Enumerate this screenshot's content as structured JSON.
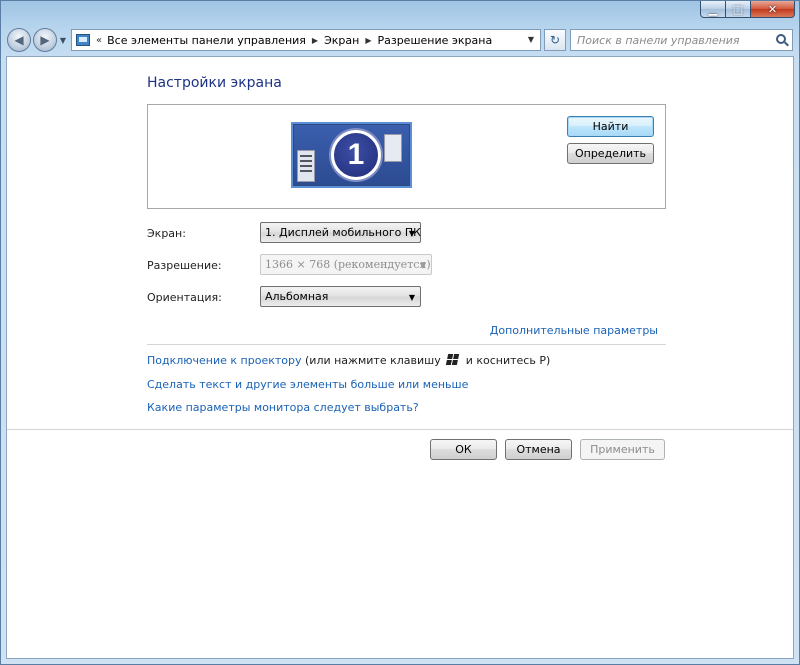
{
  "nav": {
    "breadcrumbs": [
      "Все элементы панели управления",
      "Экран",
      "Разрешение экрана"
    ],
    "overflow_glyph": "«",
    "search_placeholder": "Поиск в панели управления"
  },
  "page": {
    "title": "Настройки экрана",
    "monitor_number": "1",
    "identify_buttons": {
      "find": "Найти",
      "identify": "Определить"
    }
  },
  "fields": {
    "display": {
      "label": "Экран:",
      "value": "1. Дисплей мобильного ПК"
    },
    "resolution": {
      "label": "Разрешение:",
      "value": "1366 × 768 (рекомендуется)",
      "disabled": true
    },
    "orientation": {
      "label": "Ориентация:",
      "value": "Альбомная"
    }
  },
  "links": {
    "advanced": "Дополнительные параметры",
    "projector_link": "Подключение к проектору",
    "projector_hint_before": "(или нажмите клавишу",
    "projector_hint_after": "и коснитесь Р)",
    "text_size": "Сделать текст и другие элементы больше или меньше",
    "monitor_help": "Какие параметры монитора следует выбрать?"
  },
  "footer": {
    "ok": "ОК",
    "cancel": "Отмена",
    "apply": "Применить"
  },
  "icons": [
    "minimize-icon",
    "maximize-icon",
    "close-icon",
    "back-arrow-icon",
    "forward-arrow-icon",
    "control-panel-icon",
    "refresh-icon",
    "search-icon",
    "windows-key-icon"
  ],
  "colors": {
    "link": "#1a62b5",
    "title": "#1e3287",
    "monitor_tile": "#2c4b91"
  }
}
